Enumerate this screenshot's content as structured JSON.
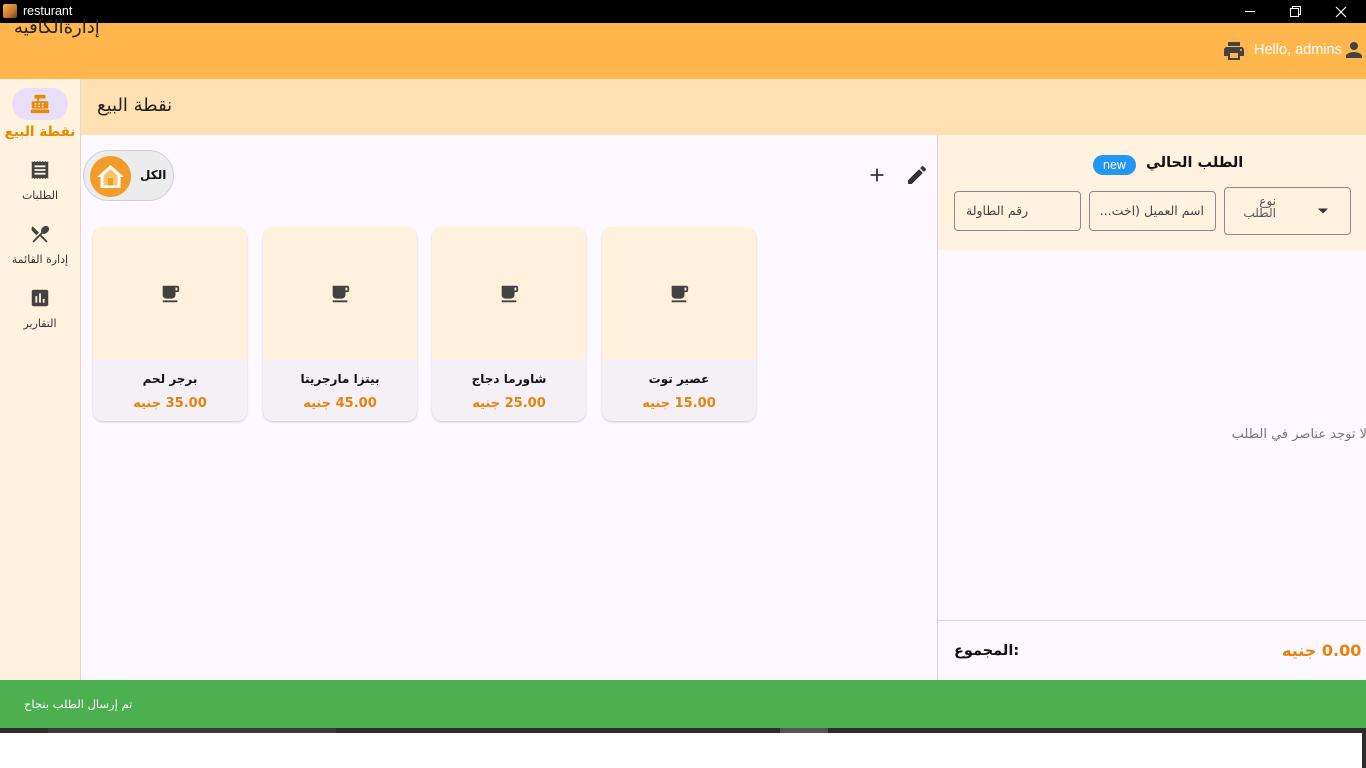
{
  "window": {
    "title": "resturant",
    "minimize_icon": "minimize-icon",
    "maximize_icon": "restore-icon",
    "close_icon": "close-icon"
  },
  "header": {
    "app_title": "إدارةالكافيه",
    "greeting": "Hello, admins",
    "printer_icon": "printer-icon",
    "user_icon": "person-icon",
    "background": "#ffb74d"
  },
  "sidebar": {
    "items": [
      {
        "label": "نقطة البيع",
        "icon": "cash-register-icon",
        "active": true
      },
      {
        "label": "الطلبات",
        "icon": "receipt-icon",
        "active": false
      },
      {
        "label": "إدارة القائمة",
        "icon": "restaurant-menu-icon",
        "active": false
      },
      {
        "label": "التقارير",
        "icon": "reports-icon",
        "active": false
      }
    ]
  },
  "page": {
    "title": "نقطة البيع"
  },
  "categories": [
    {
      "label": "الكل",
      "icon": "home-icon"
    }
  ],
  "toolbar": {
    "add_icon": "add-icon",
    "edit_icon": "edit-icon"
  },
  "products": [
    {
      "name": "عصير توت",
      "price": "15.00 جنيه",
      "icon": "coffee-cup-icon"
    },
    {
      "name": "شاورما دجاج",
      "price": "25.00 جنيه",
      "icon": "coffee-cup-icon"
    },
    {
      "name": "بيتزا مارجريتا",
      "price": "45.00 جنيه",
      "icon": "coffee-cup-icon"
    },
    {
      "name": "برجر لحم",
      "price": "35.00 جنيه",
      "icon": "coffee-cup-icon"
    }
  ],
  "order": {
    "title": "الطلب الحالي",
    "badge": "new",
    "order_type": {
      "label": "نوع الطلب",
      "value": ""
    },
    "customer_name": {
      "placeholder": "اسم العميل (اختياري)",
      "display": "...اسم العميل (اخت"
    },
    "table_number": {
      "placeholder": "رقم الطاولة",
      "value": ""
    },
    "empty_message": "لا توجد عناصر في الطلب",
    "total_label": "المجموع:",
    "total_value": "0.00 جنيه"
  },
  "snackbar": {
    "message": "تم إرسال الطلب بنجاح",
    "background": "#4caf50"
  },
  "colors": {
    "accent": "#e8820c",
    "sidebar_bg": "#fff3e0",
    "page_header_bg": "#ffe0b2",
    "badge_blue": "#2196f3"
  }
}
